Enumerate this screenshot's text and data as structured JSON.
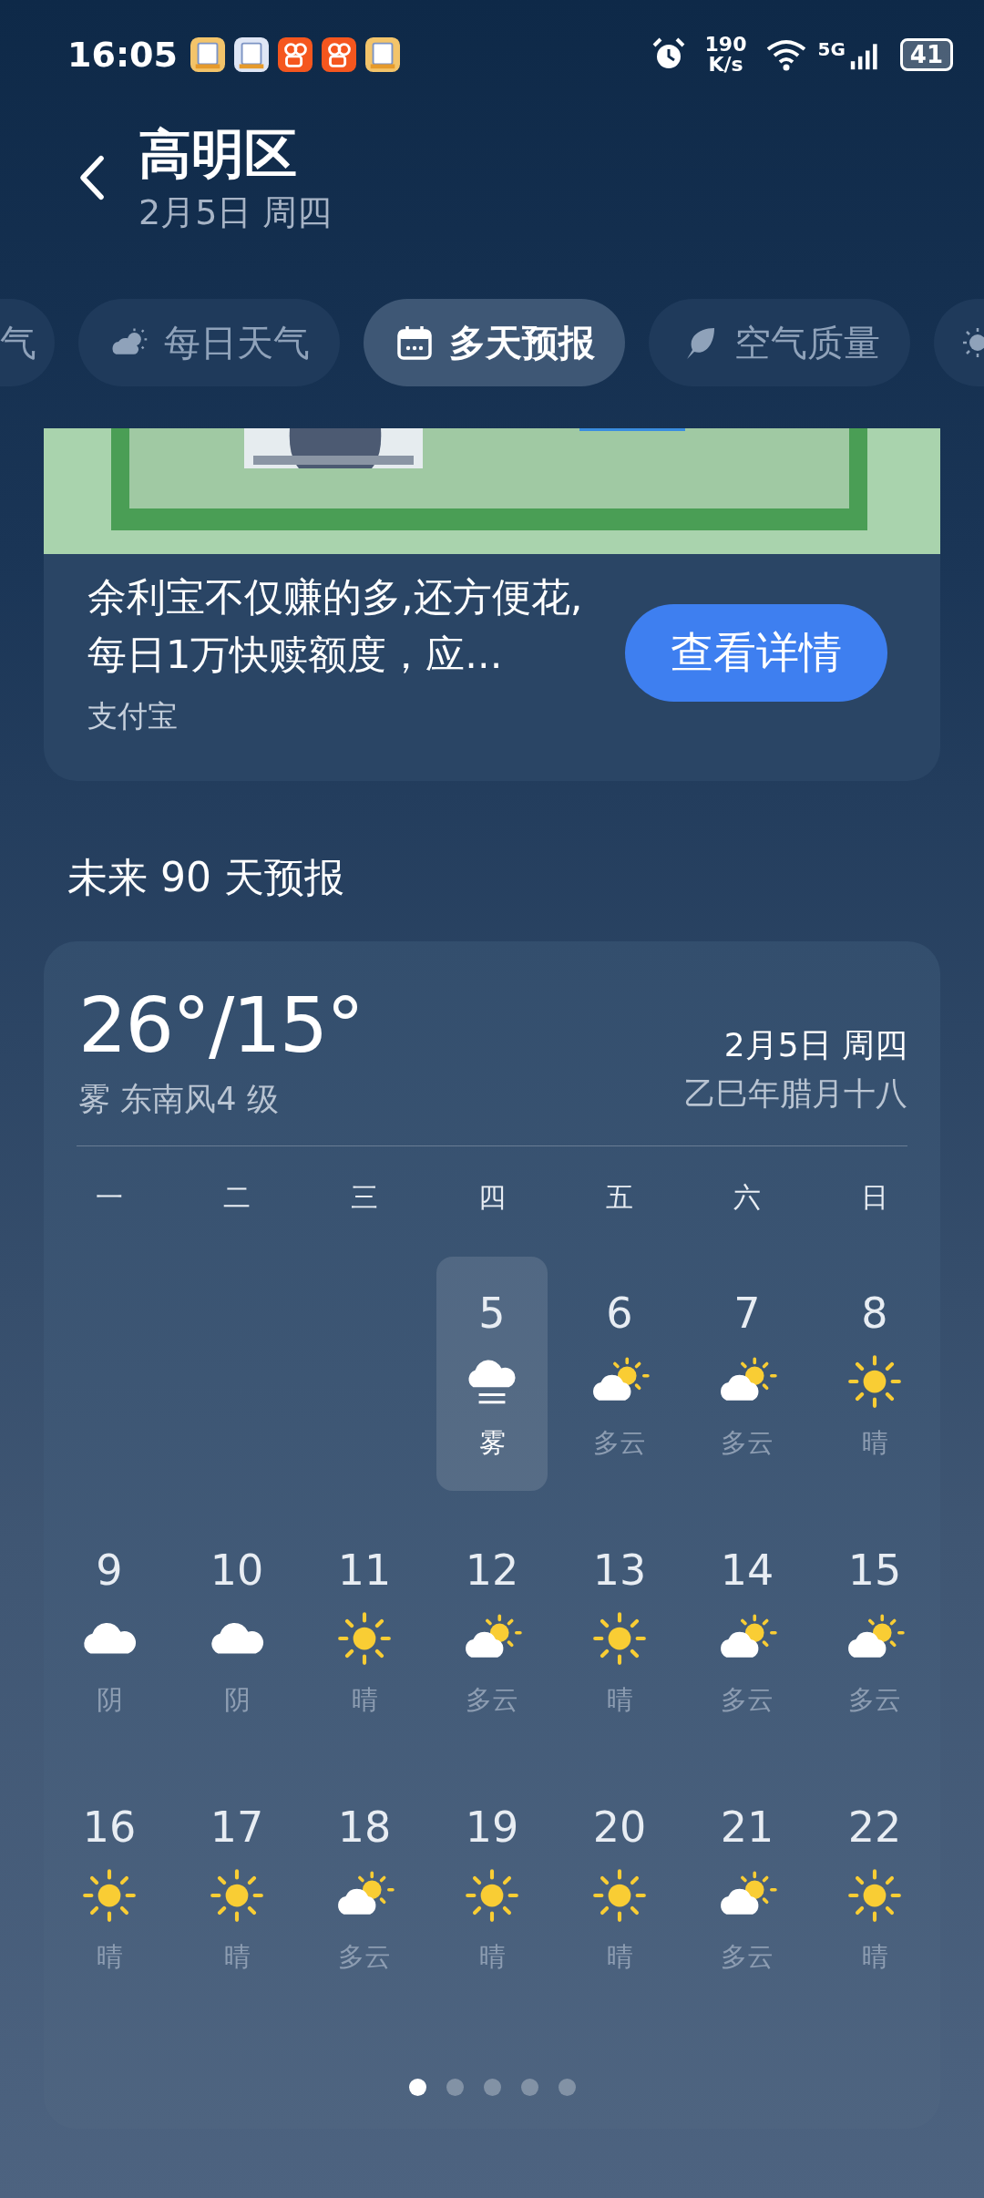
{
  "status_bar": {
    "time": "16:05",
    "speed_value": "190",
    "speed_unit": "K/s",
    "network": "5G",
    "battery": "41"
  },
  "header": {
    "title": "高明区",
    "date": "2月5日 周四"
  },
  "tabs": [
    {
      "label": "气",
      "selected": false
    },
    {
      "label": "每日天气",
      "selected": false
    },
    {
      "label": "多天预报",
      "selected": true
    },
    {
      "label": "空气质量",
      "selected": false
    },
    {
      "selected": false
    }
  ],
  "ad": {
    "text": "余利宝不仅赚的多,还方便花,每日1万快赎额度，应...",
    "source": "支付宝",
    "button": "查看详情"
  },
  "section_title": "未来 90 天预报",
  "calendar": {
    "temperature": "26°/15°",
    "condition": "雾 东南风4 级",
    "date": "2月5日 周四",
    "lunar_date": "乙巳年腊月十八",
    "weekdays": [
      "一",
      "二",
      "三",
      "四",
      "五",
      "六",
      "日"
    ],
    "weeks": [
      [
        {
          "kind": "empty"
        },
        {
          "kind": "empty"
        },
        {
          "kind": "empty"
        },
        {
          "kind": "fog",
          "day": "5",
          "label": "雾",
          "selected": true
        },
        {
          "kind": "partly_cloudy",
          "day": "6",
          "label": "多云",
          "selected": false
        },
        {
          "kind": "partly_cloudy",
          "day": "7",
          "label": "多云",
          "selected": false
        },
        {
          "kind": "sunny",
          "day": "8",
          "label": "晴",
          "selected": false
        }
      ],
      [
        {
          "kind": "cloudy",
          "day": "9",
          "label": "阴",
          "selected": false
        },
        {
          "kind": "cloudy",
          "day": "10",
          "label": "阴",
          "selected": false
        },
        {
          "kind": "sunny",
          "day": "11",
          "label": "晴",
          "selected": false
        },
        {
          "kind": "partly_cloudy",
          "day": "12",
          "label": "多云",
          "selected": false
        },
        {
          "kind": "sunny",
          "day": "13",
          "label": "晴",
          "selected": false
        },
        {
          "kind": "partly_cloudy",
          "day": "14",
          "label": "多云",
          "selected": false
        },
        {
          "kind": "partly_cloudy",
          "day": "15",
          "label": "多云",
          "selected": false
        }
      ],
      [
        {
          "kind": "sunny",
          "day": "16",
          "label": "晴",
          "selected": false
        },
        {
          "kind": "sunny",
          "day": "17",
          "label": "晴",
          "selected": false
        },
        {
          "kind": "partly_cloudy",
          "day": "18",
          "label": "多云",
          "selected": false
        },
        {
          "kind": "sunny",
          "day": "19",
          "label": "晴",
          "selected": false
        },
        {
          "kind": "sunny",
          "day": "20",
          "label": "晴",
          "selected": false
        },
        {
          "kind": "partly_cloudy",
          "day": "21",
          "label": "多云",
          "selected": false
        },
        {
          "kind": "sunny",
          "day": "22",
          "label": "晴",
          "selected": false
        }
      ]
    ],
    "pager": [
      {
        "selected": true
      },
      {
        "selected": false
      },
      {
        "selected": false
      },
      {
        "selected": false
      },
      {
        "selected": false
      }
    ]
  }
}
